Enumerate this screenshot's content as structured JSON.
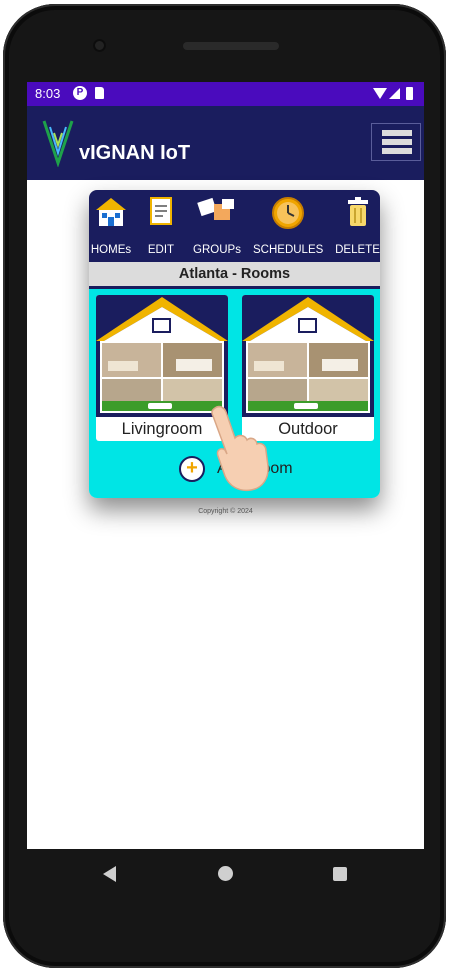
{
  "status": {
    "time": "8:03",
    "p_icon": "P"
  },
  "app": {
    "title": "vIGNAN IoT"
  },
  "toolbar": {
    "items": [
      {
        "label": "HOMEs",
        "icon": "house-icon"
      },
      {
        "label": "EDIT",
        "icon": "edit-icon"
      },
      {
        "label": "GROUPs",
        "icon": "groups-icon"
      },
      {
        "label": "SCHEDULES",
        "icon": "clock-icon"
      },
      {
        "label": "DELETE",
        "icon": "trash-icon"
      }
    ]
  },
  "page": {
    "subtitle": "Atlanta - Rooms"
  },
  "rooms": [
    {
      "name": "Livingroom"
    },
    {
      "name": "Outdoor"
    }
  ],
  "add_room": {
    "icon": "+",
    "label": "Add Room"
  },
  "footer": {
    "copyright": "Copyright © 2024"
  },
  "colors": {
    "status_bar": "#4a0bbd",
    "app_bar": "#1a1d5e",
    "rooms_bg": "#00e5e5",
    "roof": "#f0b400"
  }
}
